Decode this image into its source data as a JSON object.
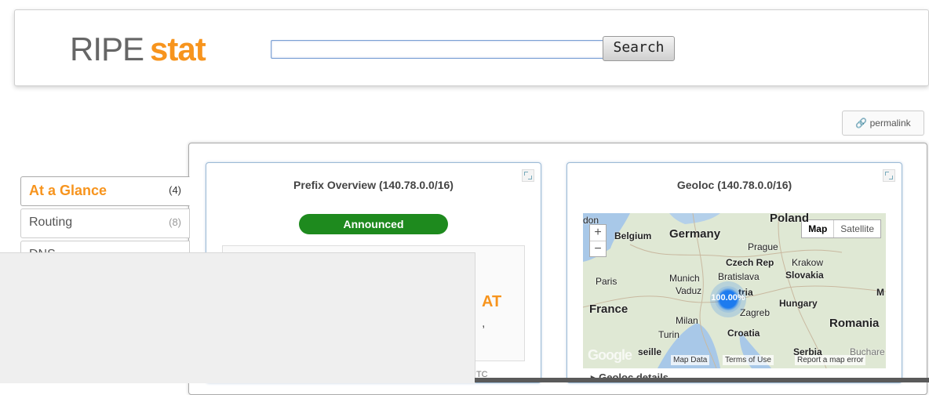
{
  "header": {
    "logo_part1": "RIPE",
    "logo_part2": "stat",
    "search_value": "",
    "search_button": "Search"
  },
  "permalink": {
    "icon": "link-icon",
    "label": "permalink"
  },
  "sidebar": {
    "tabs": [
      {
        "label": "At a Glance",
        "count": "(4)",
        "active": true
      },
      {
        "label": "Routing",
        "count": "(8)",
        "active": false
      },
      {
        "label": "DNS",
        "count": "",
        "active": false
      }
    ]
  },
  "widgets": {
    "prefix_overview": {
      "title": "Prefix Overview (140.78.0.0/16)",
      "status": "Announced",
      "status_color": "#1e8a1e",
      "inner_text": "AT",
      "inner_sub": ",",
      "footer": "UTC"
    },
    "geoloc": {
      "title": "Geoloc (140.78.0.0/16)",
      "map_controls": {
        "zoom_in": "+",
        "zoom_out": "−",
        "map": "Map",
        "satellite": "Satellite"
      },
      "labels": {
        "don": "don",
        "belgium": "Belgium",
        "germany": "Germany",
        "poland": "Poland",
        "prague": "Prague",
        "czech": "Czech Rep",
        "krakow": "Krakow",
        "paris": "Paris",
        "munich": "Munich",
        "bratislava": "Bratislava",
        "slovakia": "Slovakia",
        "vaduz": "Vaduz",
        "austria": "tria",
        "m": "M",
        "hungary": "Hungary",
        "france": "France",
        "milan": "Milan",
        "zagreb": "Zagreb",
        "romania": "Romania",
        "turin": "Turin",
        "croatia": "Croatia",
        "serbia": "Serbia",
        "buchare": "Buchare",
        "marseille": "seille"
      },
      "cluster_label": "100.00%",
      "google": "Google",
      "map_data": "Map Data",
      "terms": "Terms of Use",
      "report": "Report a map error",
      "details": "Geoloc details"
    }
  },
  "colors": {
    "brand_orange": "#f7941d",
    "logo_gray": "#666666",
    "widget_border": "#9bbad6"
  }
}
